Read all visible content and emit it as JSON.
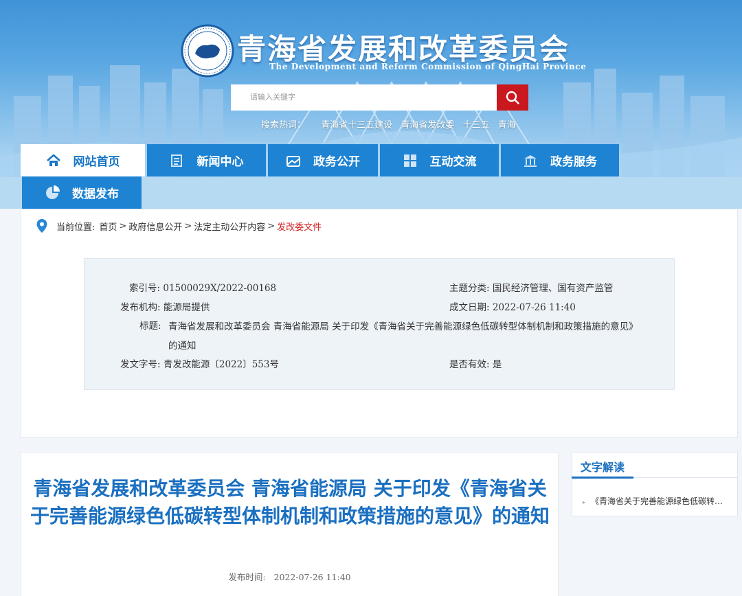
{
  "header": {
    "title": "青海省发展和改革委员会",
    "subtitle": "The Development and Reform Commission of QingHai Province",
    "search_placeholder": "请输入关键字",
    "hot_label": "搜索热词：",
    "hot_words": [
      "青海省十三五建设",
      "青海省发改委",
      "十三五",
      "青海"
    ]
  },
  "nav": {
    "items": [
      {
        "label": "网站首页",
        "icon": "home-icon",
        "active": true
      },
      {
        "label": "新闻中心",
        "icon": "news-icon"
      },
      {
        "label": "政务公开",
        "icon": "open-gov-icon"
      },
      {
        "label": "互动交流",
        "icon": "interaction-icon"
      },
      {
        "label": "政务服务",
        "icon": "service-icon"
      },
      {
        "label": "数据发布",
        "icon": "pie-chart-icon"
      }
    ]
  },
  "breadcrumb": {
    "prefix": "当前位置:",
    "items": [
      "首页",
      "政府信息公开",
      "法定主动公开内容"
    ],
    "current": "发改委文件",
    "separator": ">"
  },
  "meta": {
    "index_label": "索引号:",
    "index_value": "01500029X/2022-00168",
    "topic_label": "主题分类:",
    "topic_value": "国民经济管理、国有资产监管",
    "issuer_label": "发布机构:",
    "issuer_value": "能源局提供",
    "date_label": "成文日期:",
    "date_value": "2022-07-26 11:40",
    "title_label": "标题:",
    "title_value": "青海省发展和改革委员会 青海省能源局 关于印发《青海省关于完善能源绿色低碳转型体制机制和政策措施的意见》的通知",
    "docno_label": "发文字号:",
    "docno_value": "青发改能源〔2022〕553号",
    "valid_label": "是否有效:",
    "valid_value": "是"
  },
  "article": {
    "title": "青海省发展和改革委员会 青海省能源局 关于印发《青海省关于完善能源绿色低碳转型体制机制和政策措施的意见》的通知",
    "pub_label": "发布时间:",
    "pub_value": "2022-07-26 11:40"
  },
  "sidebar": {
    "title": "文字解读",
    "link": "《青海省关于完善能源绿色低碳转型体制机制和政策措施的意见》解读"
  },
  "colors": {
    "nav_blue": "#1e83d2",
    "title_blue": "#1a6fc0",
    "search_red": "#c9181e",
    "current_red": "#d42020"
  }
}
